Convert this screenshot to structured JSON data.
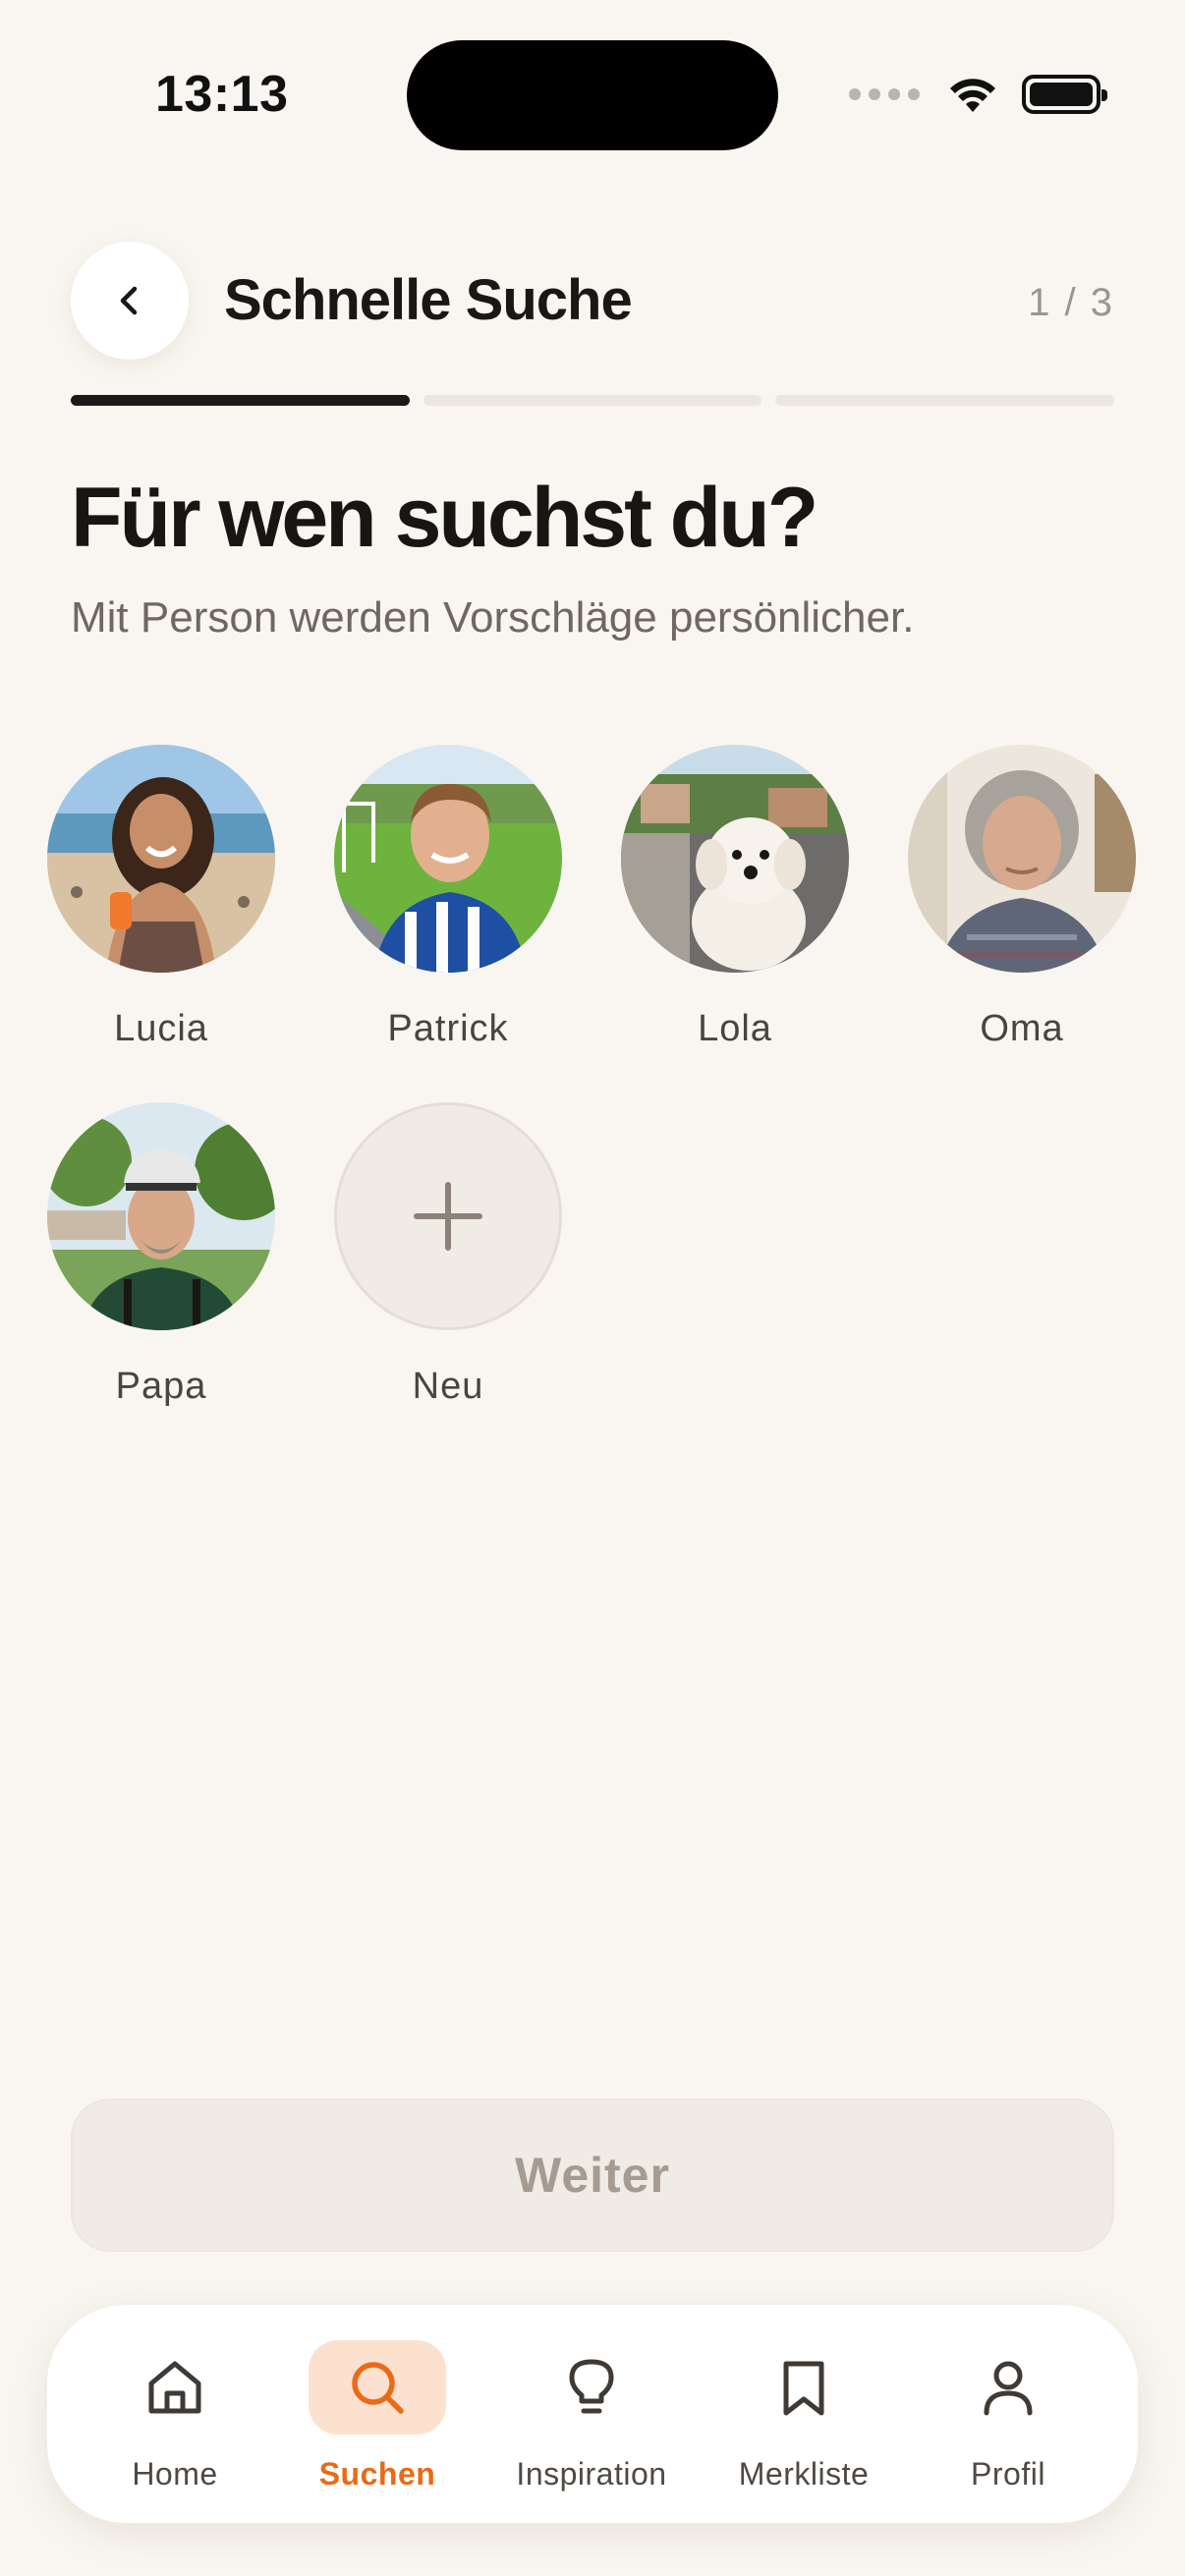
{
  "status_bar": {
    "time": "13:13"
  },
  "header": {
    "title": "Schnelle Suche",
    "step": "1 / 3",
    "progress": {
      "current": 1,
      "total": 3
    }
  },
  "question": {
    "heading": "Für wen suchst du?",
    "subtitle": "Mit Person werden Vorschläge persönlicher."
  },
  "people": [
    {
      "name": "Lucia"
    },
    {
      "name": "Patrick"
    },
    {
      "name": "Lola"
    },
    {
      "name": "Oma"
    },
    {
      "name": "Papa"
    }
  ],
  "add_person": {
    "label": "Neu"
  },
  "next_button": {
    "label": "Weiter"
  },
  "bottom_nav": {
    "items": [
      {
        "label": "Home",
        "icon": "home-icon",
        "active": false
      },
      {
        "label": "Suchen",
        "icon": "search-icon",
        "active": true
      },
      {
        "label": "Inspiration",
        "icon": "lightbulb-icon",
        "active": false
      },
      {
        "label": "Merkliste",
        "icon": "bookmark-icon",
        "active": false
      },
      {
        "label": "Profil",
        "icon": "user-icon",
        "active": false
      }
    ]
  },
  "colors": {
    "background": "#f9f6f1",
    "accent": "#ea6a17",
    "accent_soft": "#fde1cf",
    "text_primary": "#1a1714",
    "text_secondary": "#6f6861",
    "disabled_button": "#f1ebe5"
  }
}
